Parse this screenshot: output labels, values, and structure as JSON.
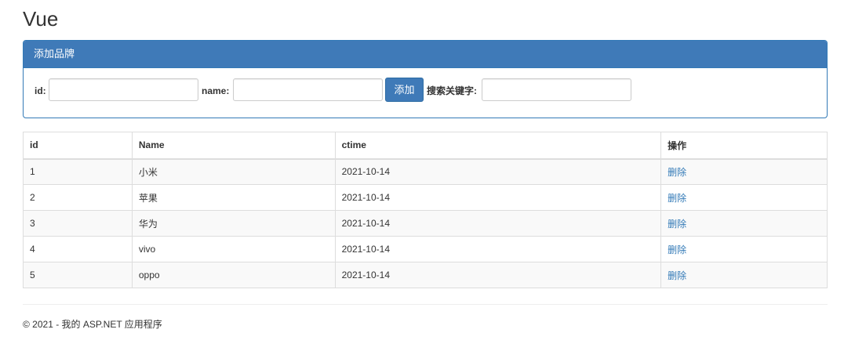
{
  "page": {
    "title": "Vue"
  },
  "panel": {
    "heading": "添加品牌",
    "id_label": "id:",
    "id_value": "",
    "name_label": "name:",
    "name_value": "",
    "add_button": "添加",
    "search_label": "搜索关键字:",
    "search_value": ""
  },
  "table": {
    "headers": {
      "id": "id",
      "name": "Name",
      "ctime": "ctime",
      "op": "操作"
    },
    "rows": [
      {
        "id": "1",
        "name": "小米",
        "ctime": "2021-10-14",
        "op": "删除"
      },
      {
        "id": "2",
        "name": "苹果",
        "ctime": "2021-10-14",
        "op": "删除"
      },
      {
        "id": "3",
        "name": "华为",
        "ctime": "2021-10-14",
        "op": "删除"
      },
      {
        "id": "4",
        "name": "vivo",
        "ctime": "2021-10-14",
        "op": "删除"
      },
      {
        "id": "5",
        "name": "oppo",
        "ctime": "2021-10-14",
        "op": "删除"
      }
    ]
  },
  "footer": {
    "text": "© 2021 - 我的 ASP.NET 应用程序"
  },
  "colors": {
    "primary": "#3f7ab8",
    "link": "#337ab7",
    "border": "#dddddd",
    "stripe": "#f9f9f9"
  }
}
